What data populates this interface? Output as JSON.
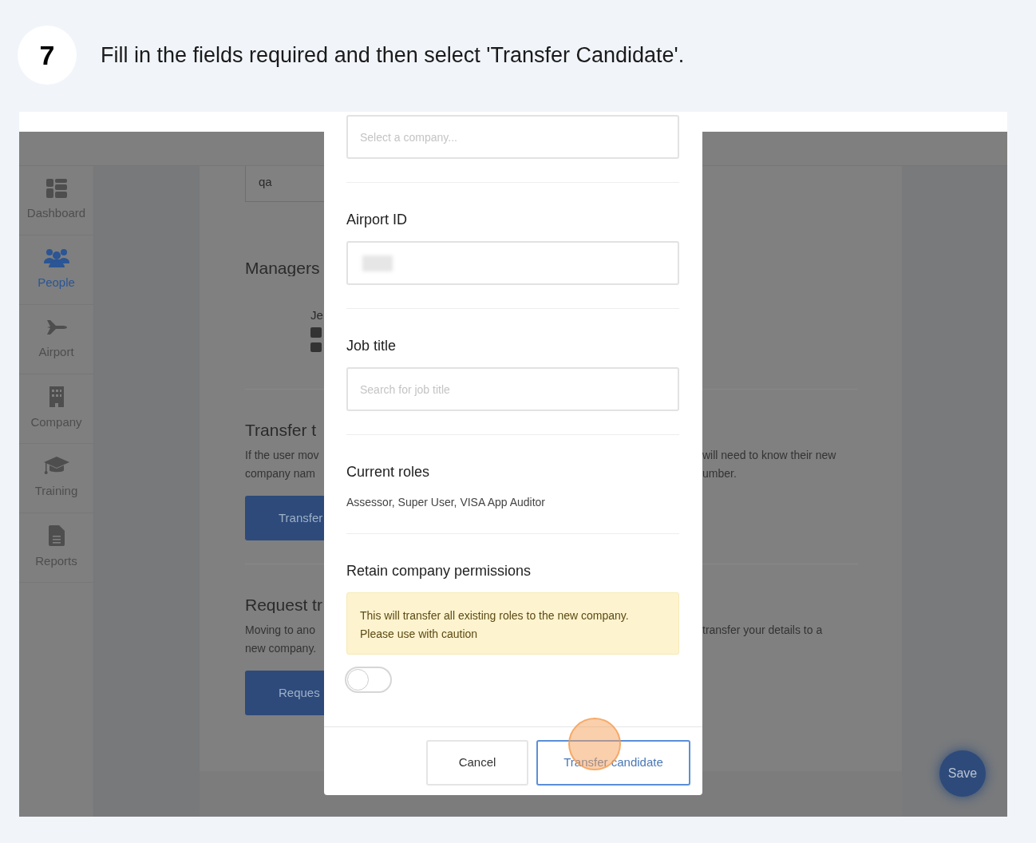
{
  "step": {
    "number": "7",
    "instruction": "Fill in the fields required and then select 'Transfer Candidate'."
  },
  "sidebar": {
    "items": [
      {
        "label": "Dashboard",
        "selected": false
      },
      {
        "label": "People",
        "selected": true
      },
      {
        "label": "Airport",
        "selected": false
      },
      {
        "label": "Company",
        "selected": false
      },
      {
        "label": "Training",
        "selected": false
      },
      {
        "label": "Reports",
        "selected": false
      }
    ]
  },
  "background_page": {
    "qa_field_value": "qa",
    "managers_heading": "Managers",
    "manager_name": "Je",
    "sections": [
      {
        "heading": "Transfer t",
        "left_lines": [
          "If the user mov",
          "company nam"
        ],
        "right_lines": [
          "will need to know their new",
          "umber."
        ],
        "button": "Transfer"
      },
      {
        "heading": "Request tr",
        "left_lines": [
          "Moving to ano",
          "new company."
        ],
        "right_lines": [
          "transfer your details to a"
        ],
        "button": "Reques"
      }
    ],
    "save_button": "Save"
  },
  "modal": {
    "company_field": {
      "placeholder": "Select a company..."
    },
    "fields": [
      {
        "label": "Airport ID",
        "kind": "redacted"
      },
      {
        "label": "Job title",
        "kind": "input",
        "placeholder": "Search for job title"
      }
    ],
    "current_roles": {
      "label": "Current roles",
      "value": "Assessor, Super User, VISA App Auditor"
    },
    "retain": {
      "label": "Retain company permissions",
      "warning_lines": [
        "This will transfer all existing roles to the new company.",
        "Please use with caution"
      ],
      "on": false
    },
    "buttons": [
      {
        "label": "Cancel",
        "kind": "secondary"
      },
      {
        "label": "Transfer candidate",
        "kind": "primary"
      }
    ]
  }
}
